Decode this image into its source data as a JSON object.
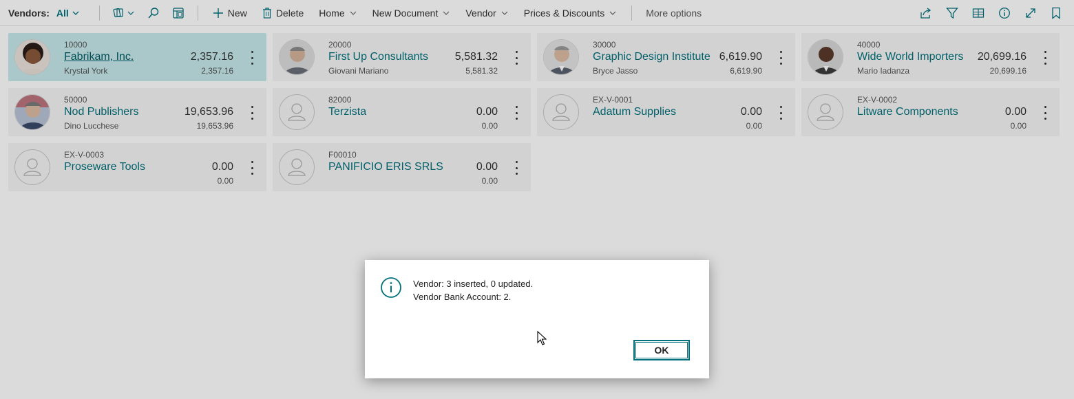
{
  "toolbar": {
    "title": "Vendors:",
    "filter": "All",
    "new_label": "New",
    "delete_label": "Delete",
    "home_label": "Home",
    "new_document_label": "New Document",
    "vendor_label": "Vendor",
    "prices_label": "Prices & Discounts",
    "more_options": "More options"
  },
  "vendors": [
    {
      "no": "10000",
      "name": "Fabrikam, Inc.",
      "contact": "Krystal York",
      "balance": "2,357.16",
      "balance_due": "2,357.16"
    },
    {
      "no": "20000",
      "name": "First Up Consultants",
      "contact": "Giovani Mariano",
      "balance": "5,581.32",
      "balance_due": "5,581.32"
    },
    {
      "no": "30000",
      "name": "Graphic Design Institute",
      "contact": "Bryce Jasso",
      "balance": "6,619.90",
      "balance_due": "6,619.90"
    },
    {
      "no": "40000",
      "name": "Wide World Importers",
      "contact": "Mario Iadanza",
      "balance": "20,699.16",
      "balance_due": "20,699.16"
    },
    {
      "no": "50000",
      "name": "Nod Publishers",
      "contact": "Dino Lucchese",
      "balance": "19,653.96",
      "balance_due": "19,653.96"
    },
    {
      "no": "82000",
      "name": "Terzista",
      "contact": "",
      "balance": "0.00",
      "balance_due": "0.00"
    },
    {
      "no": "EX-V-0001",
      "name": "Adatum Supplies",
      "contact": "",
      "balance": "0.00",
      "balance_due": "0.00"
    },
    {
      "no": "EX-V-0002",
      "name": "Litware Components",
      "contact": "",
      "balance": "0.00",
      "balance_due": "0.00"
    },
    {
      "no": "EX-V-0003",
      "name": "Proseware Tools",
      "contact": "",
      "balance": "0.00",
      "balance_due": "0.00"
    },
    {
      "no": "F00010",
      "name": "PANIFICIO ERIS SRLS",
      "contact": "",
      "balance": "0.00",
      "balance_due": "0.00"
    }
  ],
  "dialog": {
    "line1": "Vendor: 3 inserted, 0 updated.",
    "line2": "Vendor Bank Account: 2.",
    "ok_label": "OK"
  },
  "colors": {
    "accent": "#00707c",
    "selected_card": "#c6e9ec",
    "card_bg": "#f5f5f5"
  }
}
